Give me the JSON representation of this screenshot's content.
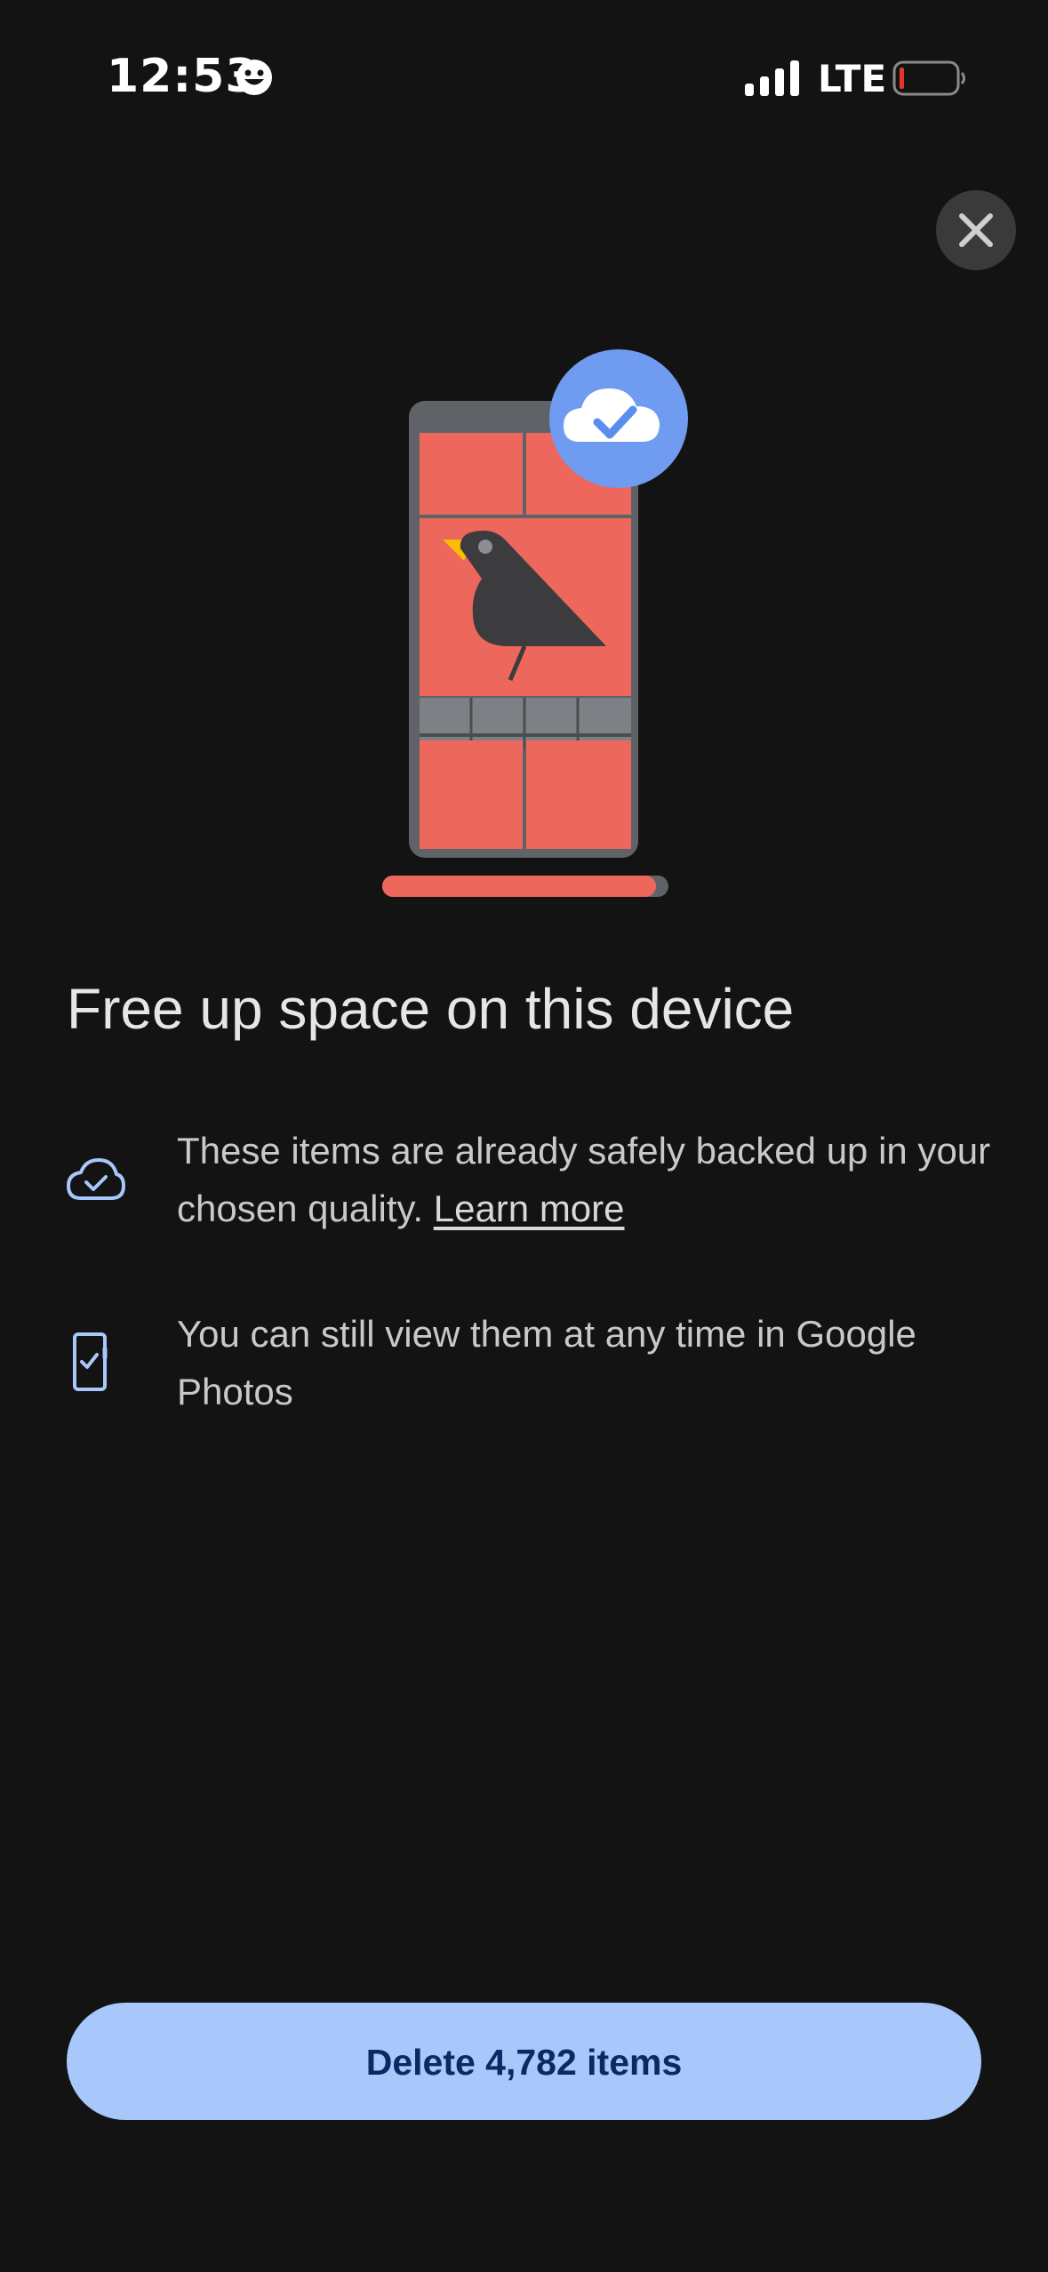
{
  "status_bar": {
    "time": "12:53",
    "network": "LTE",
    "icons": [
      "smiley-emoji",
      "signal-bars",
      "battery-low"
    ]
  },
  "header": {
    "close_icon": "close-x"
  },
  "illustration": {
    "icons": [
      "phone",
      "cloud-check",
      "bird"
    ]
  },
  "title": "Free up space on this device",
  "info_rows": [
    {
      "icon": "cloud-check-outline",
      "text": "These items are already safely backed up in your chosen quality.",
      "link": "Learn more"
    },
    {
      "icon": "phone-check-outline",
      "text": "You can still view them at any time in Google Photos"
    }
  ],
  "primary_action": {
    "label": "Delete 4,782 items"
  },
  "colors": {
    "background": "#131313",
    "accent": "#a8c7fa",
    "accent_text": "#0a2a66",
    "icon_blue": "#a8c7fa",
    "illustration_red": "#ee675c",
    "illustration_blue": "#5b8def"
  }
}
